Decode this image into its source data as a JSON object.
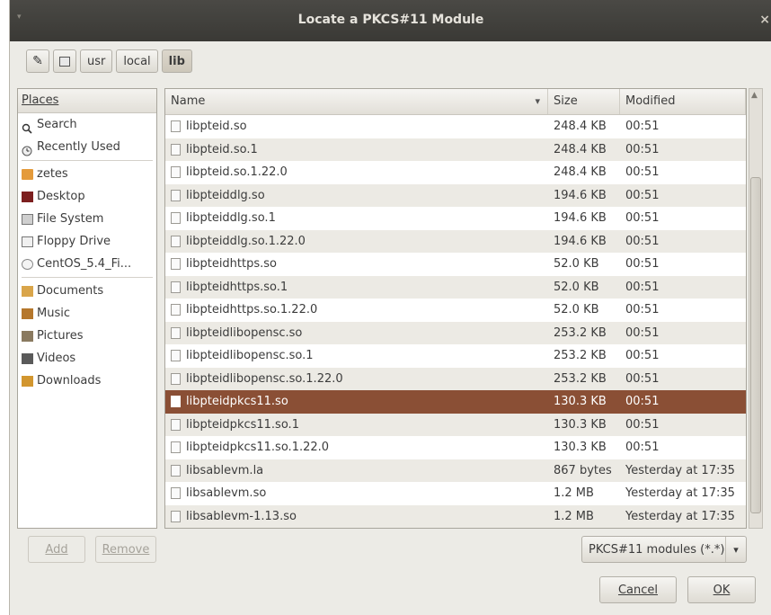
{
  "window": {
    "title": "Locate a PKCS#11 Module",
    "close": "×",
    "menu": "▾"
  },
  "pathbar": {
    "crumbs": [
      "usr",
      "local",
      "lib"
    ]
  },
  "places": {
    "header": "Places",
    "items": [
      {
        "label": "Search",
        "icon": "search-icon"
      },
      {
        "label": "Recently Used",
        "icon": "clock-icon"
      },
      {
        "label": "zetes",
        "icon": "home-folder-icon"
      },
      {
        "label": "Desktop",
        "icon": "desktop-icon"
      },
      {
        "label": "File System",
        "icon": "harddisk-icon"
      },
      {
        "label": "Floppy Drive",
        "icon": "floppy-icon"
      },
      {
        "label": "CentOS_5.4_Fi...",
        "icon": "cdrom-icon"
      },
      {
        "label": "Documents",
        "icon": "documents-folder-icon"
      },
      {
        "label": "Music",
        "icon": "music-folder-icon"
      },
      {
        "label": "Pictures",
        "icon": "pictures-folder-icon"
      },
      {
        "label": "Videos",
        "icon": "videos-folder-icon"
      },
      {
        "label": "Downloads",
        "icon": "downloads-folder-icon"
      }
    ]
  },
  "files": {
    "columns": {
      "name": "Name",
      "size": "Size",
      "modified": "Modified"
    },
    "rows": [
      {
        "name": "libpteid.so",
        "size": "248.4 KB",
        "modified": "00:51"
      },
      {
        "name": "libpteid.so.1",
        "size": "248.4 KB",
        "modified": "00:51"
      },
      {
        "name": "libpteid.so.1.22.0",
        "size": "248.4 KB",
        "modified": "00:51"
      },
      {
        "name": "libpteiddlg.so",
        "size": "194.6 KB",
        "modified": "00:51"
      },
      {
        "name": "libpteiddlg.so.1",
        "size": "194.6 KB",
        "modified": "00:51"
      },
      {
        "name": "libpteiddlg.so.1.22.0",
        "size": "194.6 KB",
        "modified": "00:51"
      },
      {
        "name": "libpteidhttps.so",
        "size": "52.0 KB",
        "modified": "00:51"
      },
      {
        "name": "libpteidhttps.so.1",
        "size": "52.0 KB",
        "modified": "00:51"
      },
      {
        "name": "libpteidhttps.so.1.22.0",
        "size": "52.0 KB",
        "modified": "00:51"
      },
      {
        "name": "libpteidlibopensc.so",
        "size": "253.2 KB",
        "modified": "00:51"
      },
      {
        "name": "libpteidlibopensc.so.1",
        "size": "253.2 KB",
        "modified": "00:51"
      },
      {
        "name": "libpteidlibopensc.so.1.22.0",
        "size": "253.2 KB",
        "modified": "00:51"
      },
      {
        "name": "libpteidpkcs11.so",
        "size": "130.3 KB",
        "modified": "00:51",
        "selected": true
      },
      {
        "name": "libpteidpkcs11.so.1",
        "size": "130.3 KB",
        "modified": "00:51"
      },
      {
        "name": "libpteidpkcs11.so.1.22.0",
        "size": "130.3 KB",
        "modified": "00:51"
      },
      {
        "name": "libsablevm.la",
        "size": "867 bytes",
        "modified": "Yesterday at 17:35"
      },
      {
        "name": "libsablevm.so",
        "size": "1.2 MB",
        "modified": "Yesterday at 17:35"
      },
      {
        "name": "libsablevm-1.13.so",
        "size": "1.2 MB",
        "modified": "Yesterday at 17:35"
      }
    ]
  },
  "buttons": {
    "add": "Add",
    "remove": "Remove",
    "cancel": "Cancel",
    "ok": "OK"
  },
  "filter": {
    "selected": "PKCS#11 modules (*.*)"
  },
  "colors": {
    "selection": "#8a4f35",
    "titlebar": "#3f3e3a",
    "window_bg": "#ecebe6"
  }
}
